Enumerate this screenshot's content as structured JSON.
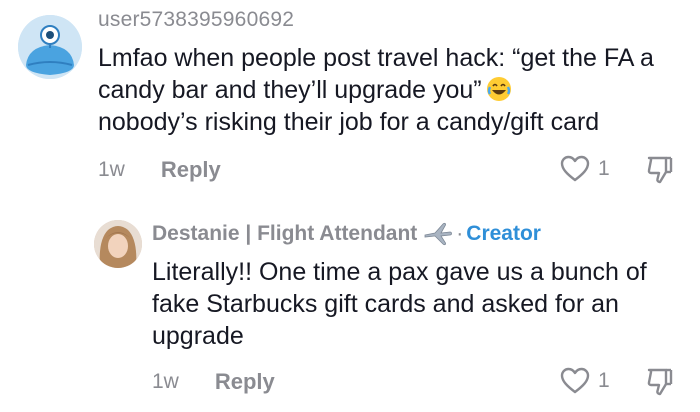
{
  "top_comment": {
    "username": "user5738395960692",
    "text": "Lmfao when people post travel hack: “get the FA a candy bar and they’ll upgrade you”",
    "text_line3": "nobody’s risking their job for a candy/gift card",
    "time": "1w",
    "reply_label": "Reply",
    "like_count": "1",
    "emoji": "face-with-tears-of-joy"
  },
  "reply_comment": {
    "username": "Destanie | Flight Attendant",
    "badge_separator": "·",
    "badge_label": "Creator",
    "text": "Literally!! One time a pax gave us a bunch of fake Starbucks gift cards and asked for an upgrade",
    "time": "1w",
    "reply_label": "Reply",
    "like_count": "1"
  },
  "colors": {
    "muted_text": "#8a8b91",
    "body_text": "#161823",
    "creator_accent": "#2f8fd8",
    "avatar_bg": "#cfe5f5"
  }
}
